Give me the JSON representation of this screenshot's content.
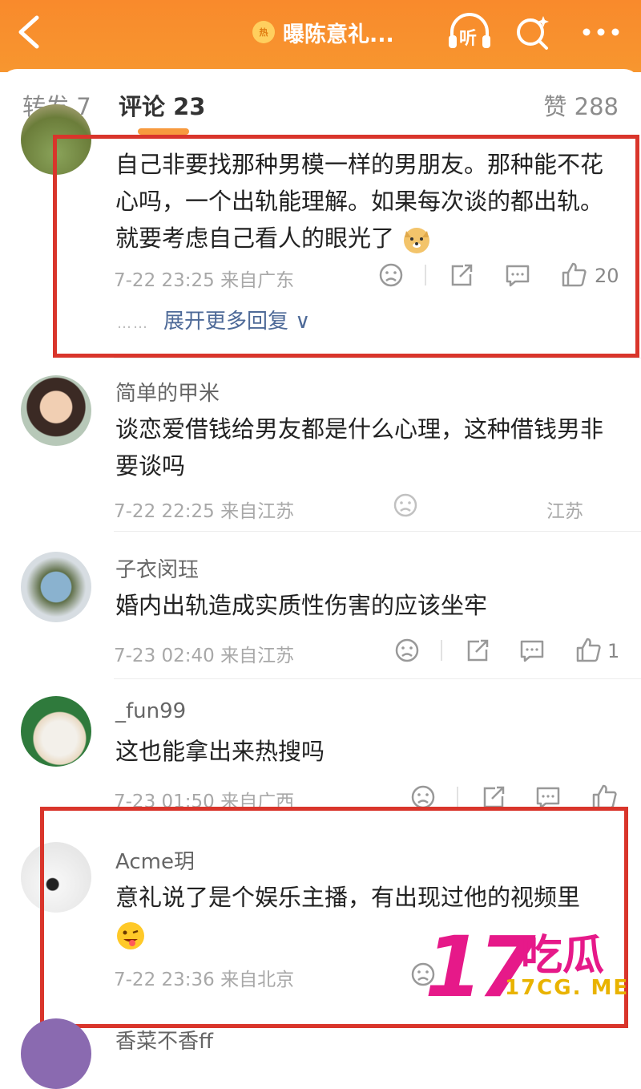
{
  "header": {
    "title": "曝陈意礼...",
    "badge": "热",
    "listen_label": "听"
  },
  "tabs": {
    "repost": "转发 7",
    "comments": "评论 23",
    "likes": "赞 288"
  },
  "comments": [
    {
      "user": "",
      "text": "自己非要找那种男模一样的男朋友。那种能不花心吗，一个出轨能理解。如果每次谈的都出轨。就要考虑自己看人的眼光了",
      "time": "7-22 23:25 来自广东",
      "likes": "20",
      "expand": "展开更多回复 ∨",
      "dots": "……"
    },
    {
      "user": "简单的甲米",
      "text": "谈恋爱借钱给男友都是什么心理，这种借钱男非要谈吗",
      "time": "7-22 22:25 来自江苏",
      "likes": "",
      "overlay": "江苏"
    },
    {
      "user": "子衣闵珏",
      "text": "婚内出轨造成实质性伤害的应该坐牢",
      "time": "7-23 02:40 来自江苏",
      "likes": "1"
    },
    {
      "user": "_fun99",
      "text": "这也能拿出来热搜吗",
      "time": "7-23 01:50 来自广西",
      "likes": ""
    },
    {
      "user": "Acme玥",
      "text": "意礼说了是个娱乐主播，有出现过他的视频里",
      "time": "7-22 23:36 来自北京",
      "likes": ""
    },
    {
      "user": "香菜不香ff",
      "text": "",
      "time": "",
      "likes": ""
    }
  ],
  "watermark": {
    "number": "17",
    "chinese": "吃瓜",
    "domain": "17CG. ME"
  },
  "colors": {
    "header": "#f98a2c",
    "highlight_box": "#d9352b",
    "link": "#4e6a98",
    "tab_underline": "#f79a3e",
    "watermark": "#e61989"
  }
}
